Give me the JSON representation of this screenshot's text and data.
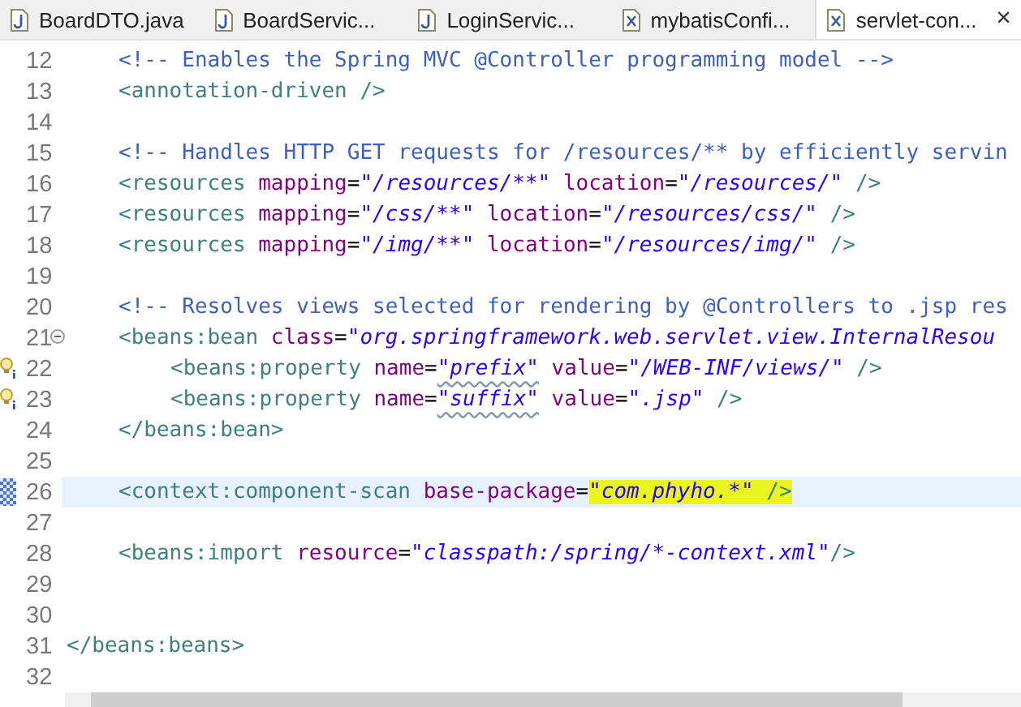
{
  "tabs": [
    {
      "label": "BoardDTO.java",
      "kind": "java",
      "selected": false
    },
    {
      "label": "BoardServic...",
      "kind": "java",
      "selected": false
    },
    {
      "label": "LoginServic...",
      "kind": "java",
      "selected": false
    },
    {
      "label": "mybatisConfi...",
      "kind": "xml",
      "selected": false
    },
    {
      "label": "servlet-con...",
      "kind": "xml",
      "selected": true,
      "close": "×"
    }
  ],
  "editor": {
    "lines": [
      {
        "children": [
          {
            "number": "12",
            "tokens": [
              {
                "kind": "comment",
                "text": "<!-- Enables the Spring MVC @Controller programming model -->"
              }
            ]
          },
          {
            "number": "13",
            "tokens": [
              {
                "kind": "tag",
                "text": "<annotation-driven />"
              }
            ]
          },
          {
            "number": "14"
          },
          {
            "number": "15",
            "tokens": [
              {
                "kind": "comment",
                "text": "<!-- Handles HTTP GET requests for /resources/** by efficiently servin"
              }
            ]
          },
          {
            "number": "16",
            "tokens": [
              {
                "kind": "tag",
                "text": "<resources"
              },
              {
                "kind": "attr",
                "text": "mapping"
              },
              {
                "kind": "eq",
                "text": "="
              },
              {
                "kind": "string",
                "text": "\"/resources/**\""
              },
              {
                "kind": "attr",
                "text": "location"
              },
              {
                "kind": "eq",
                "text": "="
              },
              {
                "kind": "string",
                "text": "\"/resources/\""
              },
              {
                "kind": "tag",
                "text": "/>"
              }
            ]
          },
          {
            "number": "17",
            "tokens": [
              {
                "kind": "tag",
                "text": "<resources"
              },
              {
                "kind": "attr",
                "text": "mapping"
              },
              {
                "kind": "eq",
                "text": "="
              },
              {
                "kind": "string",
                "text": "\"/css/**\""
              },
              {
                "kind": "attr",
                "text": "location"
              },
              {
                "kind": "eq",
                "text": "="
              },
              {
                "kind": "string",
                "text": "\"/resources/css/\""
              },
              {
                "kind": "tag",
                "text": "/>"
              }
            ]
          },
          {
            "number": "18",
            "tokens": [
              {
                "kind": "tag",
                "text": "<resources"
              },
              {
                "kind": "attr",
                "text": "mapping"
              },
              {
                "kind": "eq",
                "text": "="
              },
              {
                "kind": "string",
                "text": "\"/img/**\""
              },
              {
                "kind": "attr",
                "text": "location"
              },
              {
                "kind": "eq",
                "text": "="
              },
              {
                "kind": "string",
                "text": "\"/resources/img/\""
              },
              {
                "kind": "tag",
                "text": "/>"
              }
            ]
          },
          {
            "number": "19"
          },
          {
            "number": "20",
            "tokens": [
              {
                "kind": "comment",
                "text": "<!-- Resolves views selected for rendering by @Controllers to .jsp res"
              }
            ]
          },
          {
            "number": "21",
            "fold": true,
            "tokens": [
              {
                "kind": "tag",
                "text": "<beans:bean"
              },
              {
                "kind": "attr",
                "text": "class"
              },
              {
                "kind": "eq",
                "text": "="
              },
              {
                "kind": "string",
                "text": "\"org.springframework.web.servlet.view.InternalResou"
              }
            ],
            "children": [
              {
                "number": "22",
                "hint": true,
                "tokens": [
                  {
                    "kind": "tag",
                    "text": "<beans:property"
                  },
                  {
                    "kind": "attr",
                    "text": "name"
                  },
                  {
                    "kind": "eq",
                    "text": "="
                  },
                  {
                    "kind": "string",
                    "text": "\"prefix\"",
                    "warning": true
                  },
                  {
                    "kind": "attr",
                    "text": "value"
                  },
                  {
                    "kind": "eq",
                    "text": "="
                  },
                  {
                    "kind": "string",
                    "text": "\"/WEB-INF/views/\""
                  },
                  {
                    "kind": "tag",
                    "text": "/>"
                  }
                ]
              },
              {
                "number": "23",
                "hint": true,
                "tokens": [
                  {
                    "kind": "tag",
                    "text": "<beans:property"
                  },
                  {
                    "kind": "attr",
                    "text": "name"
                  },
                  {
                    "kind": "eq",
                    "text": "="
                  },
                  {
                    "kind": "string",
                    "text": "\"suffix\"",
                    "warning": true
                  },
                  {
                    "kind": "attr",
                    "text": "value"
                  },
                  {
                    "kind": "eq",
                    "text": "="
                  },
                  {
                    "kind": "string",
                    "text": "\".jsp\""
                  },
                  {
                    "kind": "tag",
                    "text": "/>"
                  }
                ]
              }
            ]
          },
          {
            "number": "24",
            "tokens": [
              {
                "kind": "tag",
                "text": "</beans:bean>"
              }
            ]
          },
          {
            "number": "25"
          },
          {
            "number": "26",
            "current": true,
            "tokens": [
              {
                "kind": "tag",
                "text": "<context:component-scan"
              },
              {
                "kind": "attr",
                "text": "base-package"
              },
              {
                "kind": "eq",
                "text": "="
              },
              {
                "kind": "string",
                "text": "\"com.phyho.*\"",
                "highlight": true
              },
              {
                "kind": "tag",
                "text": "/>",
                "highlight": true
              }
            ]
          },
          {
            "number": "27"
          },
          {
            "number": "28",
            "tokens": [
              {
                "kind": "tag",
                "text": "<beans:import"
              },
              {
                "kind": "attr",
                "text": "resource"
              },
              {
                "kind": "eq",
                "text": "="
              },
              {
                "kind": "string",
                "text": "\"classpath:/spring/*-context.xml\"",
                "join": true
              },
              {
                "kind": "tag",
                "text": "/>"
              }
            ]
          }
        ]
      },
      {
        "number": "29"
      },
      {
        "number": "30"
      },
      {
        "number": "31",
        "tokens": [
          {
            "kind": "tag",
            "text": "</beans:beans>"
          }
        ]
      },
      {
        "number": "32"
      }
    ]
  }
}
